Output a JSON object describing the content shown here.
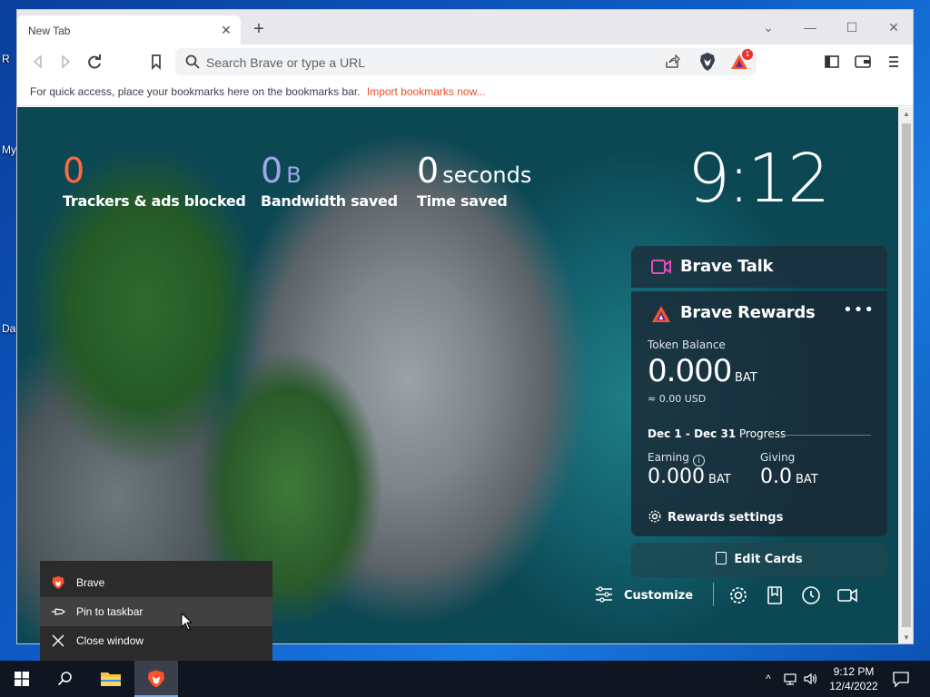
{
  "desktop": {
    "icon_slivers": [
      "R",
      "My",
      "Da"
    ]
  },
  "browser": {
    "tab": {
      "title": "New Tab",
      "close": "✕"
    },
    "new_tab_symbol": "+",
    "window_controls": {
      "dropdown": "⌄",
      "minimize": "—",
      "maximize": "☐",
      "close": "✕"
    },
    "search": {
      "placeholder": "Search Brave or type a URL"
    },
    "rewards_badge_count": "1",
    "bookmarks_bar": {
      "hint": "For quick access, place your bookmarks here on the bookmarks bar.",
      "import_link": "Import bookmarks now..."
    }
  },
  "ntp": {
    "stats": {
      "trackers": {
        "value": "0",
        "label": "Trackers & ads blocked",
        "color": "#ff6a3d"
      },
      "bandwidth": {
        "value": "0",
        "unit": "B",
        "label": "Bandwidth saved",
        "color": "#a0a5eb"
      },
      "time": {
        "value": "0",
        "unit": "seconds",
        "label": "Time saved",
        "color": "#ffffff"
      }
    },
    "clock": "9:12",
    "brave_talk": {
      "title": "Brave Talk"
    },
    "rewards": {
      "title": "Brave Rewards",
      "more": "•••",
      "token_balance_label": "Token Balance",
      "token_balance": "0.000",
      "token_unit": "BAT",
      "usd": "≈ 0.00 USD",
      "progress_range": "Dec 1 - Dec 31",
      "progress_label": "Progress",
      "earning_label": "Earning",
      "earning_value": "0.000",
      "earning_unit": "BAT",
      "giving_label": "Giving",
      "giving_value": "0.0",
      "giving_unit": "BAT",
      "settings_label": "Rewards settings"
    },
    "edit_cards_label": "Edit Cards",
    "customize_label": "Customize"
  },
  "jumplist": {
    "items": [
      {
        "label": "Brave",
        "icon": "brave-lion-icon"
      },
      {
        "label": "Pin to taskbar",
        "icon": "pin-icon"
      },
      {
        "label": "Close window",
        "icon": "close-icon"
      }
    ]
  },
  "taskbar": {
    "clock_time": "9:12 PM",
    "clock_date": "12/4/2022"
  },
  "colors": {
    "brave_orange": "#fb542b",
    "link": "#e2512b",
    "taskbar_bg": "#101522"
  }
}
